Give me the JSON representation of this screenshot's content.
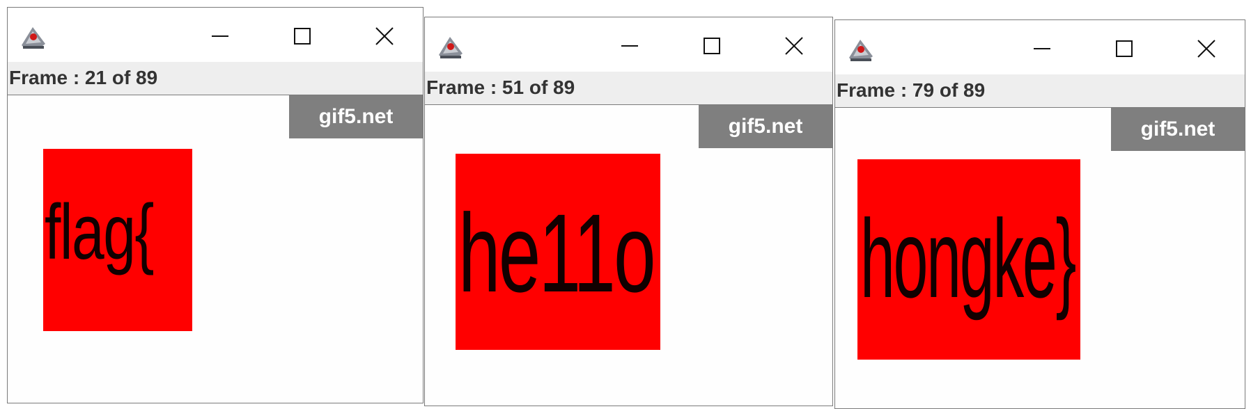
{
  "windows": [
    {
      "frame_status": "Frame : 21 of 89",
      "watermark": "gif5.net",
      "image_text": "flag{"
    },
    {
      "frame_status": "Frame : 51 of 89",
      "watermark": "gif5.net",
      "image_text": "he11o"
    },
    {
      "frame_status": "Frame : 79 of 89",
      "watermark": "gif5.net",
      "image_text": "hongke}"
    }
  ],
  "icons": {
    "app": "java-app-icon",
    "minimize": "minimize-icon",
    "maximize": "maximize-icon",
    "close": "close-icon"
  },
  "colors": {
    "image_background": "#ff0000",
    "watermark_background": "#7f7f7f",
    "frame_bar_background": "#eeeeee"
  }
}
